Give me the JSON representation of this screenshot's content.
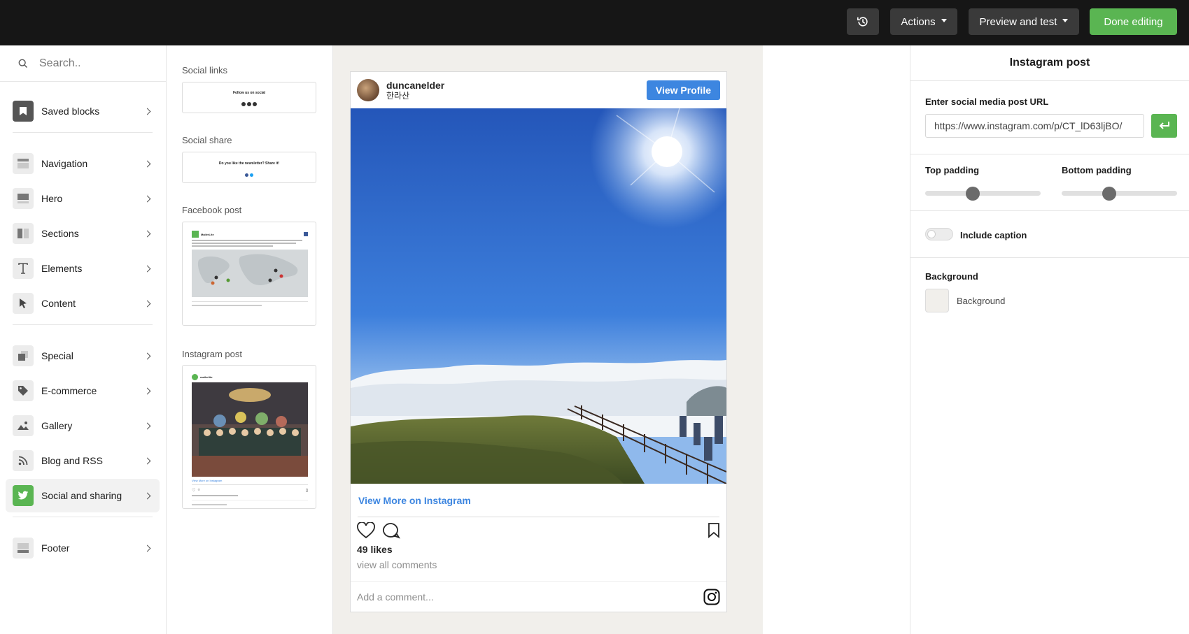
{
  "topbar": {
    "history_icon": "history-icon",
    "actions_label": "Actions",
    "preview_label": "Preview and test",
    "done_label": "Done editing"
  },
  "sidebar": {
    "search_placeholder": "Search..",
    "items": [
      {
        "label": "Saved blocks",
        "icon": "bookmark-icon"
      },
      {
        "label": "Navigation",
        "icon": "navigation-icon"
      },
      {
        "label": "Hero",
        "icon": "hero-icon"
      },
      {
        "label": "Sections",
        "icon": "sections-icon"
      },
      {
        "label": "Elements",
        "icon": "text-icon"
      },
      {
        "label": "Content",
        "icon": "cursor-icon"
      },
      {
        "label": "Special",
        "icon": "special-icon"
      },
      {
        "label": "E-commerce",
        "icon": "tag-icon"
      },
      {
        "label": "Gallery",
        "icon": "image-icon"
      },
      {
        "label": "Blog and RSS",
        "icon": "rss-icon"
      },
      {
        "label": "Social and sharing",
        "icon": "twitter-icon"
      },
      {
        "label": "Footer",
        "icon": "footer-icon"
      }
    ]
  },
  "blocks": {
    "items": [
      {
        "title": "Social links",
        "preview_text": "Follow us on social"
      },
      {
        "title": "Social share",
        "preview_text": "Do you like the newsletter? Share it!"
      },
      {
        "title": "Facebook post",
        "preview_name": "MailerLite"
      },
      {
        "title": "Instagram post",
        "preview_name": "mailerlite",
        "preview_link": "View More on Instagram"
      }
    ]
  },
  "post": {
    "username": "duncanelder",
    "location": "한라산",
    "view_profile": "View Profile",
    "view_more": "View More on Instagram",
    "likes": "49 likes",
    "comments": "view all comments",
    "add_comment": "Add a comment..."
  },
  "panel": {
    "title": "Instagram post",
    "url_label": "Enter social media post URL",
    "url_value": "https://www.instagram.com/p/CT_lD63ljBO/",
    "top_padding_label": "Top padding",
    "top_padding_value": 0.4,
    "bottom_padding_label": "Bottom padding",
    "bottom_padding_value": 0.4,
    "caption_label": "Include caption",
    "caption_on": false,
    "background_section": "Background",
    "background_label": "Background",
    "background_color": "#f1efeb"
  },
  "colors": {
    "accent_green": "#5ab552",
    "topbar": "#161616",
    "instagram_blue": "#3d86e0"
  }
}
